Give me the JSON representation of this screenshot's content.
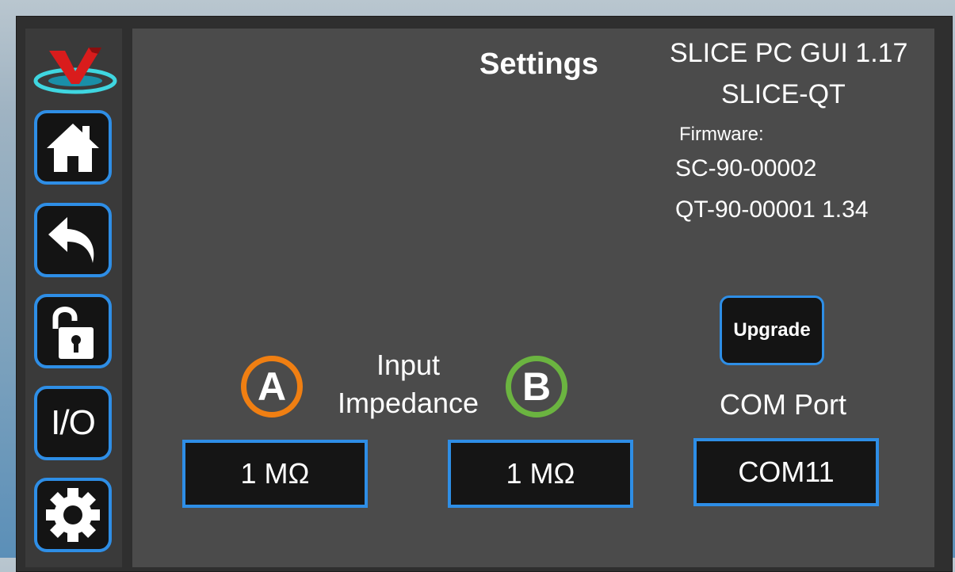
{
  "header": {
    "title": "Settings"
  },
  "info": {
    "gui_version": "SLICE PC GUI 1.17",
    "device": "SLICE-QT",
    "firmware_label": "Firmware:",
    "firmware_1": "SC-90-00002",
    "firmware_2": "QT-90-00001 1.34"
  },
  "sidebar": {
    "items": [
      {
        "icon": "home-icon"
      },
      {
        "icon": "back-icon"
      },
      {
        "icon": "unlock-icon"
      },
      {
        "label": "I/O"
      },
      {
        "icon": "gear-icon"
      }
    ]
  },
  "upgrade": {
    "label": "Upgrade"
  },
  "com": {
    "label": "COM Port",
    "value": "COM11"
  },
  "impedance": {
    "label_line1": "Input",
    "label_line2": "Impedance",
    "channel_a": {
      "badge": "A",
      "value": "1 MΩ",
      "color": "#f07f12"
    },
    "channel_b": {
      "badge": "B",
      "value": "1 MΩ",
      "color": "#6bb440"
    }
  },
  "colors": {
    "accent": "#2e8ee6",
    "panel": "#4b4b4b",
    "sidebar": "#3a3a3a",
    "button_bg": "#141414"
  }
}
